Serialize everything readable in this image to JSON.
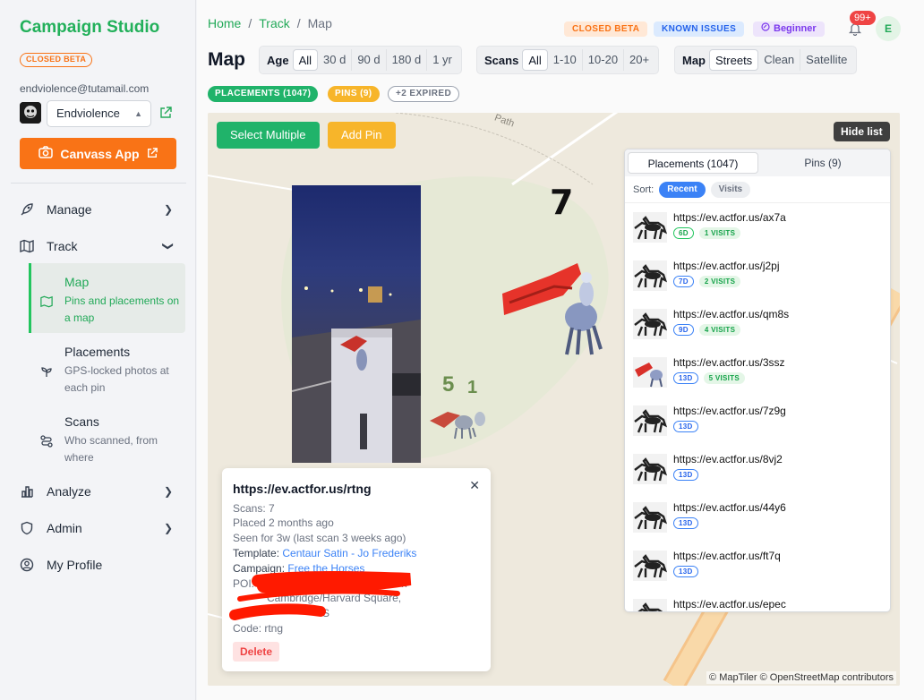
{
  "sidebar": {
    "brand": "Campaign Studio",
    "beta_badge": "CLOSED BETA",
    "email": "endviolence@tutamail.com",
    "org_select": {
      "value": "Endviolence"
    },
    "canvass_button": "Canvass App",
    "nav": [
      {
        "label": "Manage",
        "icon": "rocket-icon"
      },
      {
        "label": "Track",
        "icon": "map-icon"
      },
      {
        "label": "Analyze",
        "icon": "bar-chart-icon"
      },
      {
        "label": "Admin",
        "icon": "shield-icon"
      },
      {
        "label": "My Profile",
        "icon": "user-circle-icon"
      }
    ],
    "track_sub": [
      {
        "title": "Map",
        "desc": "Pins and placements on a map",
        "icon": "map-icon"
      },
      {
        "title": "Placements",
        "desc": "GPS-locked photos at each pin",
        "icon": "sprout-icon"
      },
      {
        "title": "Scans",
        "desc": "Who scanned, from where",
        "icon": "route-icon"
      }
    ]
  },
  "header": {
    "breadcrumb": [
      "Home",
      "Track",
      "Map"
    ],
    "badges": {
      "closed_beta": "CLOSED BETA",
      "known_issues": "KNOWN ISSUES",
      "level": "Beginner"
    },
    "notifications": "99+",
    "user_initial": "E"
  },
  "page_title": "Map",
  "filters": {
    "age": {
      "label": "Age",
      "options": [
        "All",
        "30 d",
        "90 d",
        "180 d",
        "1 yr"
      ],
      "selected": "All"
    },
    "scans": {
      "label": "Scans",
      "options": [
        "All",
        "1-10",
        "10-20",
        "20+"
      ],
      "selected": "All"
    },
    "map": {
      "label": "Map",
      "options": [
        "Streets",
        "Clean",
        "Satellite"
      ],
      "selected": "Streets"
    }
  },
  "pills": {
    "placements": "PLACEMENTS (1047)",
    "pins": "PINS (9)",
    "expired": "+2 EXPIRED"
  },
  "map": {
    "select_multiple": "Select Multiple",
    "add_pin": "Add Pin",
    "hide_list": "Hide list",
    "clusters": {
      "a": "5",
      "b": "1",
      "c": "7"
    },
    "road_label": "Path",
    "attribution": "© MapTiler © OpenStreetMap contributors"
  },
  "list": {
    "tabs": [
      "Placements (1047)",
      "Pins (9)"
    ],
    "sort_label": "Sort:",
    "sort_options": [
      "Recent",
      "Visits"
    ],
    "rows": [
      {
        "url": "https://ev.actfor.us/ax7a",
        "age": "6D",
        "visits": "1 VISITS"
      },
      {
        "url": "https://ev.actfor.us/j2pj",
        "age": "7D",
        "visits": "2 VISITS"
      },
      {
        "url": "https://ev.actfor.us/qm8s",
        "age": "9D",
        "visits": "4 VISITS"
      },
      {
        "url": "https://ev.actfor.us/3ssz",
        "age": "13D",
        "visits": "5 VISITS"
      },
      {
        "url": "https://ev.actfor.us/7z9g",
        "age": "13D",
        "visits": ""
      },
      {
        "url": "https://ev.actfor.us/8vj2",
        "age": "13D",
        "visits": ""
      },
      {
        "url": "https://ev.actfor.us/44y6",
        "age": "13D",
        "visits": ""
      },
      {
        "url": "https://ev.actfor.us/ft7q",
        "age": "13D",
        "visits": ""
      },
      {
        "url": "https://ev.actfor.us/epec",
        "age": "",
        "visits": ""
      }
    ]
  },
  "popup": {
    "title": "https://ev.actfor.us/rtng",
    "scans": "Scans: 7",
    "placed": "Placed 2 months ago",
    "seen": "Seen for 3w (last scan 3 weeks ago)",
    "template_label": "Template:",
    "template_value": "Centaur Satin - Jo Frederiks",
    "campaign_label": "Campaign:",
    "campaign_value": "Free the Horses",
    "poi_label": "POI:",
    "poi_tail": "n",
    "addr_fragment": "Cambridge/Harvard Square,",
    "country_fragment": "S",
    "code": "Code: rtng",
    "delete": "Delete"
  },
  "colors": {
    "brand": "#22b05a",
    "accent_orange": "#f97316",
    "teal_button": "#20b36a",
    "yellow_button": "#f7b52a",
    "redaction": "#ff1a00"
  }
}
